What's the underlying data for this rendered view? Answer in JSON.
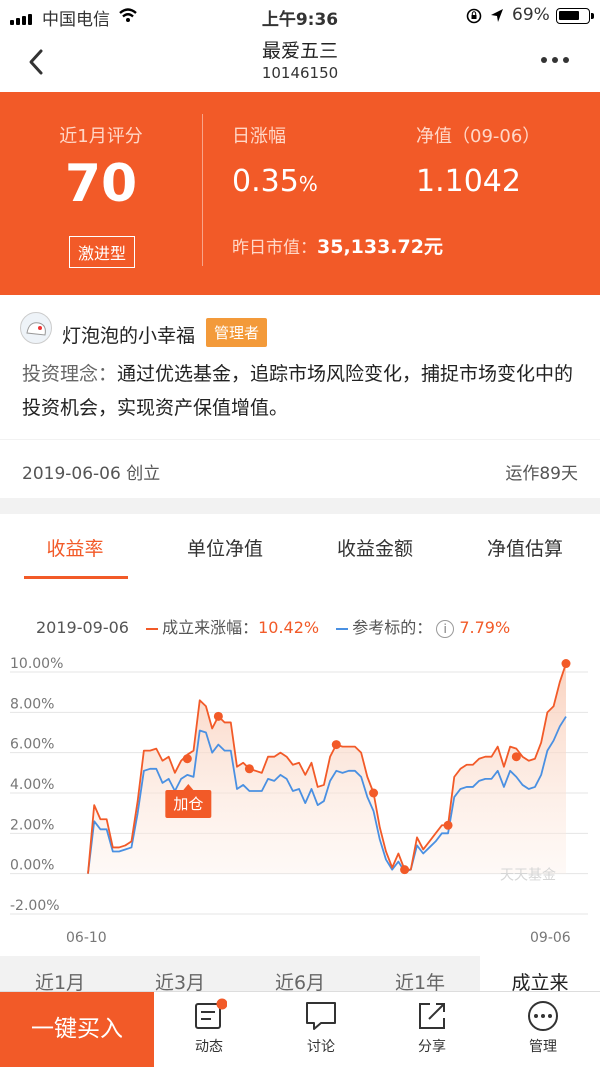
{
  "status_bar": {
    "carrier": "中国电信",
    "time": "上午9:36",
    "battery": "69%"
  },
  "nav": {
    "title": "最爱五三",
    "code": "10146150"
  },
  "hero": {
    "score_label": "近1月评分",
    "score": "70",
    "style_tag": "激进型",
    "daily_label": "日涨幅",
    "daily_value": "0.35",
    "daily_unit": "%",
    "nav_label": "净值（09-06）",
    "nav_value": "1.1042",
    "mv_label": "昨日市值：",
    "mv_value": "35,133.72元"
  },
  "manager": {
    "name": "灯泡泡的小幸福",
    "badge": "管理者",
    "idea_label": "投资理念：",
    "idea_text": "通过优选基金，追踪市场风险变化，捕捉市场变化中的投资机会，实现资产保值增值。"
  },
  "created": {
    "date": "2019-06-06 创立",
    "running": "运作89天"
  },
  "tabs": [
    "收益率",
    "单位净值",
    "收益金额",
    "净值估算"
  ],
  "legend": {
    "date": "2019-09-06",
    "main_label": "成立来涨幅：",
    "main_value": "10.42%",
    "ref_label": "参考标的：",
    "ref_value": "7.79%"
  },
  "chart_data": {
    "type": "line",
    "x_start": "06-10",
    "x_end": "09-06",
    "ylim": [
      -2,
      10
    ],
    "y_ticks": [
      "10.00%",
      "8.00%",
      "6.00%",
      "4.00%",
      "2.00%",
      "0.00%",
      "-2.00%"
    ],
    "watermark": "天天基金",
    "add_label": "加仓",
    "colors": {
      "main": "#f25a28",
      "ref": "#4a90e2"
    },
    "series": [
      {
        "values": [
          0,
          3.4,
          2.7,
          2.7,
          1.3,
          1.3,
          1.4,
          1.6,
          3.6,
          6.1,
          6.1,
          6.2,
          5.6,
          5.8,
          5.0,
          5.6,
          5.9,
          6.1,
          8.6,
          8.3,
          7.2,
          7.8,
          7.5,
          7.5,
          5.3,
          5.5,
          5.2,
          5.1,
          5.0,
          5.8,
          5.8,
          6.0,
          5.8,
          5.4,
          5.5,
          4.9,
          5.5,
          4.3,
          4.4,
          5.8,
          6.4,
          6.3,
          6.3,
          6.3,
          6.0,
          4.8,
          4.0,
          2.3,
          1.1,
          0.3,
          1.0,
          0.2,
          0.2,
          1.8,
          1.2,
          1.6,
          2.0,
          2.4,
          2.4,
          4.8,
          5.2,
          5.4,
          5.4,
          5.7,
          5.8,
          5.8,
          6.3,
          5.3,
          6.3,
          6.2,
          5.8,
          5.6,
          5.7,
          6.5,
          8.0,
          8.3,
          9.5,
          10.42
        ]
      },
      {
        "values": [
          0,
          2.6,
          2.2,
          2.2,
          1.1,
          1.1,
          1.2,
          1.3,
          3.0,
          5.1,
          5.2,
          5.2,
          4.5,
          4.7,
          4.1,
          4.7,
          4.9,
          4.8,
          7.1,
          7.0,
          6.0,
          6.4,
          6.1,
          6.1,
          4.2,
          4.4,
          4.1,
          4.1,
          4.1,
          4.7,
          4.6,
          4.9,
          4.7,
          4.1,
          4.2,
          3.5,
          4.2,
          3.4,
          3.6,
          4.6,
          5.1,
          5.0,
          5.1,
          5.1,
          4.8,
          3.8,
          3.1,
          1.7,
          0.7,
          0.2,
          0.6,
          0.1,
          0.2,
          1.4,
          1.0,
          1.3,
          1.6,
          2.0,
          2.0,
          3.8,
          4.2,
          4.3,
          4.3,
          4.6,
          4.7,
          4.7,
          5.1,
          4.3,
          5.1,
          4.8,
          4.4,
          4.2,
          4.3,
          4.9,
          6.1,
          6.6,
          7.3,
          7.79
        ]
      }
    ],
    "markers": [
      {
        "i": 16,
        "y": 5.7
      },
      {
        "i": 21,
        "y": 7.8
      },
      {
        "i": 26,
        "y": 5.2
      },
      {
        "i": 40,
        "y": 6.4
      },
      {
        "i": 46,
        "y": 4.0
      },
      {
        "i": 51,
        "y": 0.2
      },
      {
        "i": 58,
        "y": 2.4
      },
      {
        "i": 69,
        "y": 5.8
      },
      {
        "i": 77,
        "y": 10.42
      }
    ]
  },
  "periods": [
    "近1月",
    "近3月",
    "近6月",
    "近1年",
    "成立来"
  ],
  "bottom": {
    "buy": "一键买入",
    "items": [
      "动态",
      "讨论",
      "分享",
      "管理"
    ]
  }
}
